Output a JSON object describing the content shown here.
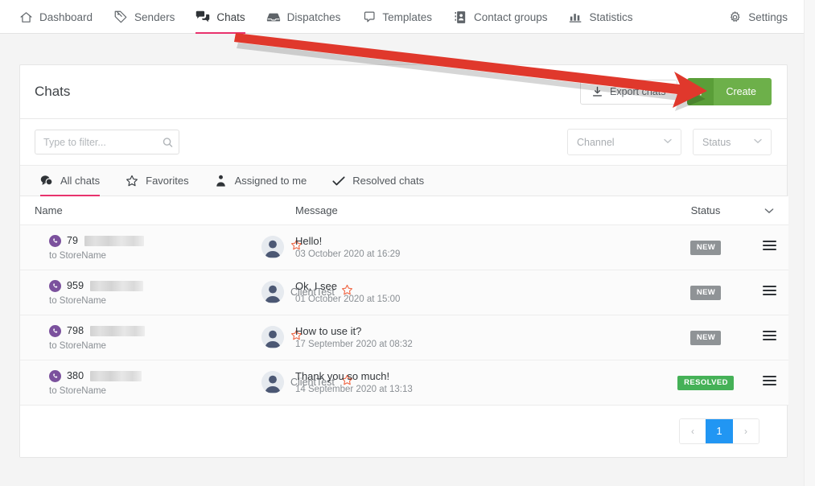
{
  "nav": {
    "items": [
      {
        "label": "Dashboard",
        "icon": "home-icon",
        "active": false
      },
      {
        "label": "Senders",
        "icon": "tag-icon",
        "active": false
      },
      {
        "label": "Chats",
        "icon": "chat-bubble-icon",
        "active": true
      },
      {
        "label": "Dispatches",
        "icon": "inbox-icon",
        "active": false
      },
      {
        "label": "Templates",
        "icon": "template-icon",
        "active": false
      },
      {
        "label": "Contact groups",
        "icon": "contact-card-icon",
        "active": false
      },
      {
        "label": "Statistics",
        "icon": "bar-chart-icon",
        "active": false
      }
    ],
    "settings": {
      "label": "Settings",
      "icon": "gear-icon"
    }
  },
  "header": {
    "title": "Chats",
    "export_label": "Export chats",
    "export_icon": "download-icon",
    "create_label": "Create",
    "create_plus": "+"
  },
  "filters": {
    "search_placeholder": "Type to filter...",
    "search_value": "",
    "search_icon": "search-icon",
    "channel_label": "Channel",
    "status_label": "Status",
    "caret": "⌄"
  },
  "tabs": [
    {
      "label": "All chats",
      "icon": "chats-icon",
      "active": true
    },
    {
      "label": "Favorites",
      "icon": "star-icon",
      "active": false
    },
    {
      "label": "Assigned to me",
      "icon": "assignee-icon",
      "active": false
    },
    {
      "label": "Resolved chats",
      "icon": "checkmark-icon",
      "active": false
    }
  ],
  "table": {
    "columns": {
      "name": "Name",
      "message": "Message",
      "status": "Status",
      "sort_caret": "⌄"
    },
    "rows": [
      {
        "phone_prefix": "79",
        "phone_redacted_width": 74,
        "to_label": "to StoreName",
        "channel_icon": "viber-icon",
        "client_name": "",
        "favorite": false,
        "message": "Hello!",
        "date": "03 October 2020 at 16:29",
        "status": "NEW",
        "status_kind": "new"
      },
      {
        "phone_prefix": "959",
        "phone_redacted_width": 66,
        "to_label": "to StoreName",
        "channel_icon": "viber-icon",
        "client_name": "ClientTest",
        "favorite": false,
        "message": "Ok, I see",
        "date": "01 October 2020 at 15:00",
        "status": "NEW",
        "status_kind": "new"
      },
      {
        "phone_prefix": "798",
        "phone_redacted_width": 68,
        "to_label": "to StoreName",
        "channel_icon": "viber-icon",
        "client_name": "",
        "favorite": false,
        "message": "How to use it?",
        "date": "17 September 2020 at 08:32",
        "status": "NEW",
        "status_kind": "new"
      },
      {
        "phone_prefix": "380",
        "phone_redacted_width": 64,
        "to_label": "to StoreName",
        "channel_icon": "viber-icon",
        "client_name": "ClientTest",
        "favorite": false,
        "message": "Thank you so much!",
        "date": "14 September 2020 at 13:13",
        "status": "RESOLVED",
        "status_kind": "resolved"
      }
    ],
    "row_menu_icon": "row-menu-icon"
  },
  "pagination": {
    "prev": "‹",
    "next": "›",
    "pages": [
      "1"
    ],
    "current": "1"
  },
  "annotation": {
    "arrow_color": "#e0382c",
    "arrow_shadow": "rgba(0,0,0,0.16)"
  },
  "colors": {
    "accent_pink": "#e8336d",
    "create_green": "#6db04a",
    "create_green_dark": "#5a9e38",
    "resolved_green": "#45b157",
    "new_gray": "#8f9396",
    "page_blue": "#2196f3",
    "viber_purple": "#7b519d",
    "star_orange": "#f06543"
  }
}
